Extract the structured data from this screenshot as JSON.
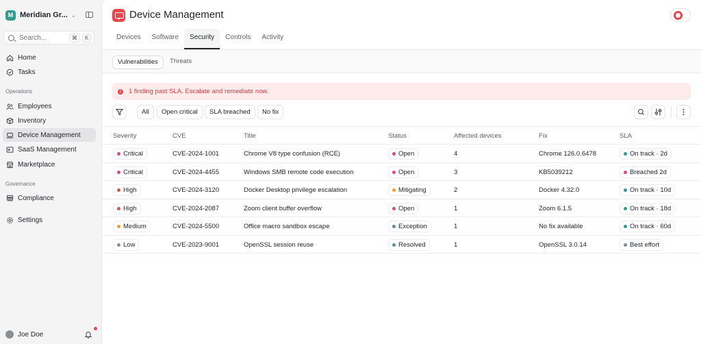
{
  "sidebar": {
    "org": {
      "initial": "M",
      "name": "Meridian Gr..."
    },
    "search": {
      "placeholder": "Search...",
      "kbd1": "⌘",
      "kbd2": "K"
    },
    "nav_top": [
      {
        "label": "Home",
        "icon": "home-icon"
      },
      {
        "label": "Tasks",
        "icon": "check-circle-icon"
      }
    ],
    "section_operations": "Operations",
    "nav_operations": [
      {
        "label": "Employees",
        "icon": "users-icon"
      },
      {
        "label": "Inventory",
        "icon": "box-icon"
      },
      {
        "label": "Device Management",
        "icon": "laptop-icon",
        "active": true
      },
      {
        "label": "SaaS Management",
        "icon": "app-window-icon"
      },
      {
        "label": "Marketplace",
        "icon": "store-icon"
      }
    ],
    "section_governance": "Governance",
    "nav_governance": [
      {
        "label": "Compliance",
        "icon": "stack-icon"
      }
    ],
    "nav_bottom": [
      {
        "label": "Settings",
        "icon": "gear-icon"
      }
    ],
    "user": {
      "name": "Joe Doe"
    }
  },
  "header": {
    "title": "Device Management"
  },
  "tabs": [
    {
      "label": "Devices"
    },
    {
      "label": "Software"
    },
    {
      "label": "Security",
      "active": true
    },
    {
      "label": "Controls"
    },
    {
      "label": "Activity"
    }
  ],
  "subtabs": [
    {
      "label": "Vulnerabilities",
      "active": true
    },
    {
      "label": "Threats"
    }
  ],
  "alert": {
    "text": "1 finding past SLA. Escalate and remediate now."
  },
  "filters": [
    "All",
    "Open critical",
    "SLA breached",
    "No fix"
  ],
  "columns": [
    "Severity",
    "CVE",
    "Title",
    "Status",
    "Affected devices",
    "Fix",
    "SLA"
  ],
  "colors": {
    "critical": "#e0457b",
    "high": "#d9534f",
    "medium": "#f0a020",
    "low": "#7c8f9c",
    "open": "#e0457b",
    "mitigating": "#f0a020",
    "exception": "#5b8f9c",
    "resolved": "#5b8f9c",
    "on_track": "#2f9c8f",
    "breached": "#e0457b",
    "best_effort": "#7c8f9c"
  },
  "rows": [
    {
      "severity": "Critical",
      "sev_color": "critical",
      "cve": "CVE-2024-1001",
      "title": "Chrome V8 type confusion (RCE)",
      "status": "Open",
      "status_color": "open",
      "affected": "4",
      "fix": "Chrome 126.0.6478",
      "sla": "On track · 2d",
      "sla_color": "on_track"
    },
    {
      "severity": "Critical",
      "sev_color": "critical",
      "cve": "CVE-2024-4455",
      "title": "Windows SMB remote code execution",
      "status": "Open",
      "status_color": "open",
      "affected": "3",
      "fix": "KB5039212",
      "sla": "Breached 2d",
      "sla_color": "breached"
    },
    {
      "severity": "High",
      "sev_color": "high",
      "cve": "CVE-2024-3120",
      "title": "Docker Desktop privilege escalation",
      "status": "Mitigating",
      "status_color": "mitigating",
      "affected": "2",
      "fix": "Docker 4.32.0",
      "sla": "On track · 10d",
      "sla_color": "on_track"
    },
    {
      "severity": "High",
      "sev_color": "high",
      "cve": "CVE-2024-2087",
      "title": "Zoom client buffer overflow",
      "status": "Open",
      "status_color": "open",
      "affected": "1",
      "fix": "Zoom 6.1.5",
      "sla": "On track · 18d",
      "sla_color": "on_track"
    },
    {
      "severity": "Medium",
      "sev_color": "medium",
      "cve": "CVE-2024-5500",
      "title": "Office macro sandbox escape",
      "status": "Exception",
      "status_color": "exception",
      "affected": "1",
      "fix": "No fix available",
      "sla": "On track · 60d",
      "sla_color": "on_track"
    },
    {
      "severity": "Low",
      "sev_color": "low",
      "cve": "CVE-2023-9001",
      "title": "OpenSSL session reuse",
      "status": "Resolved",
      "status_color": "resolved",
      "affected": "1",
      "fix": "OpenSSL 3.0.14",
      "sla": "Best effort",
      "sla_color": "best_effort"
    }
  ]
}
